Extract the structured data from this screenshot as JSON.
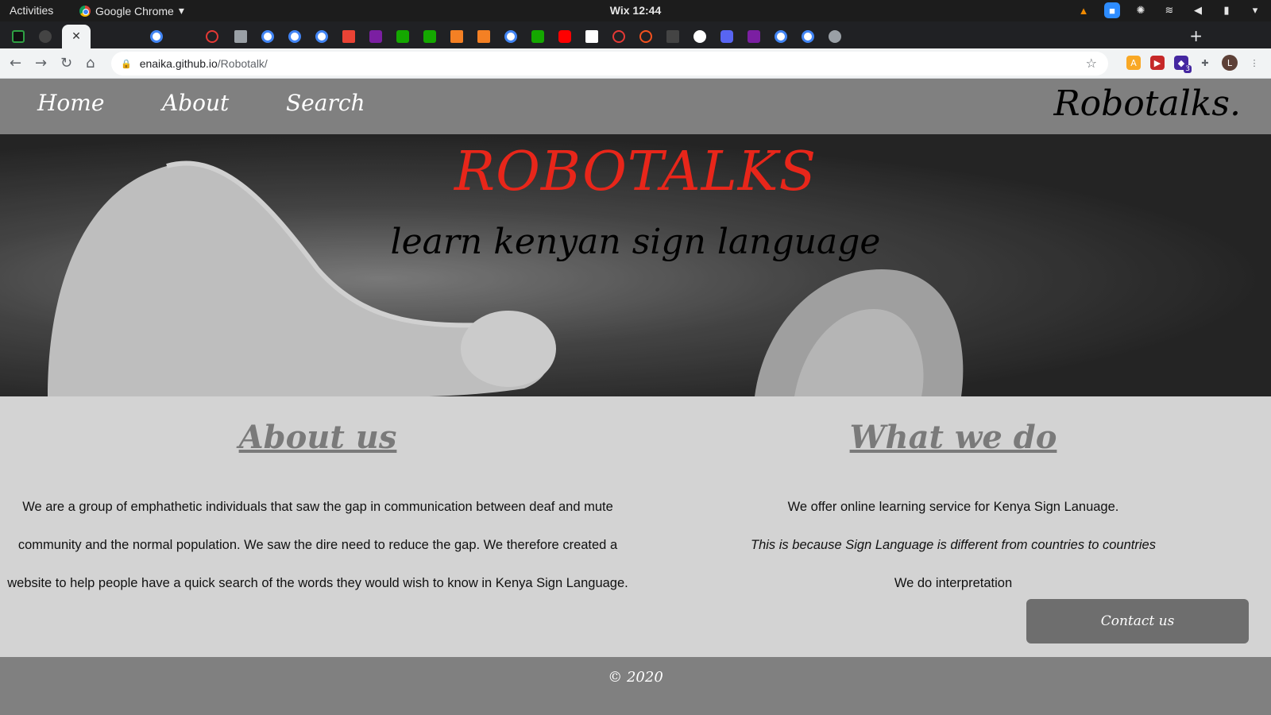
{
  "os_bar": {
    "activities": "Activities",
    "app_name": "Google Chrome",
    "clock": "Wix 12:44"
  },
  "browser": {
    "url_host": "enaika.github.io",
    "url_path": "/Robotalk/",
    "active_tab_close": "✕",
    "new_tab": "+",
    "profile_initial": "L",
    "extension_badge": "3"
  },
  "site": {
    "nav": {
      "home": "Home",
      "about": "About",
      "search": "Search"
    },
    "brand": "Robotalks.",
    "hero": {
      "title": "ROBOTALKS",
      "subtitle": "learn kenyan sign language"
    },
    "about": {
      "heading": "About us",
      "lines": [
        "We are a group of emphathetic individuals that saw the gap in communication between deaf and mute",
        "community and the normal population. We saw the dire need to reduce the gap. We therefore created a",
        "website to help people have a quick search of the words they would wish to know in Kenya Sign Language."
      ]
    },
    "what_we_do": {
      "heading": "What we do",
      "line1": "We offer online learning service for Kenya Sign Lanuage.",
      "line2": "This is because Sign Language is different from countries to countries",
      "line3": "We do interpretation"
    },
    "contact_button": "Contact us",
    "footer": "© 2020"
  },
  "colors": {
    "nav_bg": "#808080",
    "hero_title": "#e8261a",
    "content_bg": "#d3d3d3",
    "button_bg": "#6e6e6e"
  }
}
